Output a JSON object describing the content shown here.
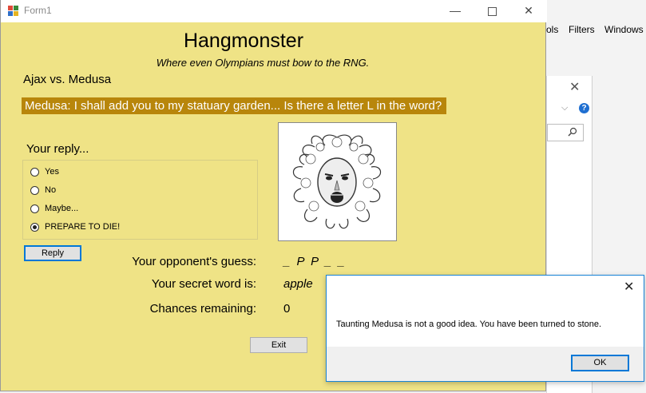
{
  "background_app": {
    "menu": [
      "ols",
      "Filters",
      "Windows"
    ],
    "help_glyph": "?"
  },
  "window": {
    "title": "Form1",
    "controls": {
      "minimize": "—",
      "close": "✕"
    }
  },
  "game": {
    "title": "Hangmonster",
    "subtitle": "Where even Olympians must bow to the RNG.",
    "matchup": "Ajax vs. Medusa",
    "opponent_message": "Medusa: I shall add you to my statuary garden... Is there a letter L in the word?",
    "banner_color": "#b8860b",
    "form_color": "#efe386"
  },
  "reply": {
    "label": "Your reply...",
    "options": [
      {
        "label": "Yes",
        "checked": false
      },
      {
        "label": "No",
        "checked": false
      },
      {
        "label": "Maybe...",
        "checked": false
      },
      {
        "label": "PREPARE TO DIE!",
        "checked": true
      }
    ],
    "button_label": "Reply"
  },
  "portrait": {
    "icon": "medusa-portrait"
  },
  "stats": {
    "guess_label": "Your opponent's guess:",
    "guess_value": "_ P P _ _",
    "secret_label": "Your secret word is:",
    "secret_value": "apple",
    "chances_label": "Chances remaining:",
    "chances_value": "0"
  },
  "exit_label": "Exit",
  "dialog": {
    "close_glyph": "✕",
    "message": "Taunting Medusa is not a good idea. You have been turned to stone.",
    "ok_label": "OK"
  }
}
